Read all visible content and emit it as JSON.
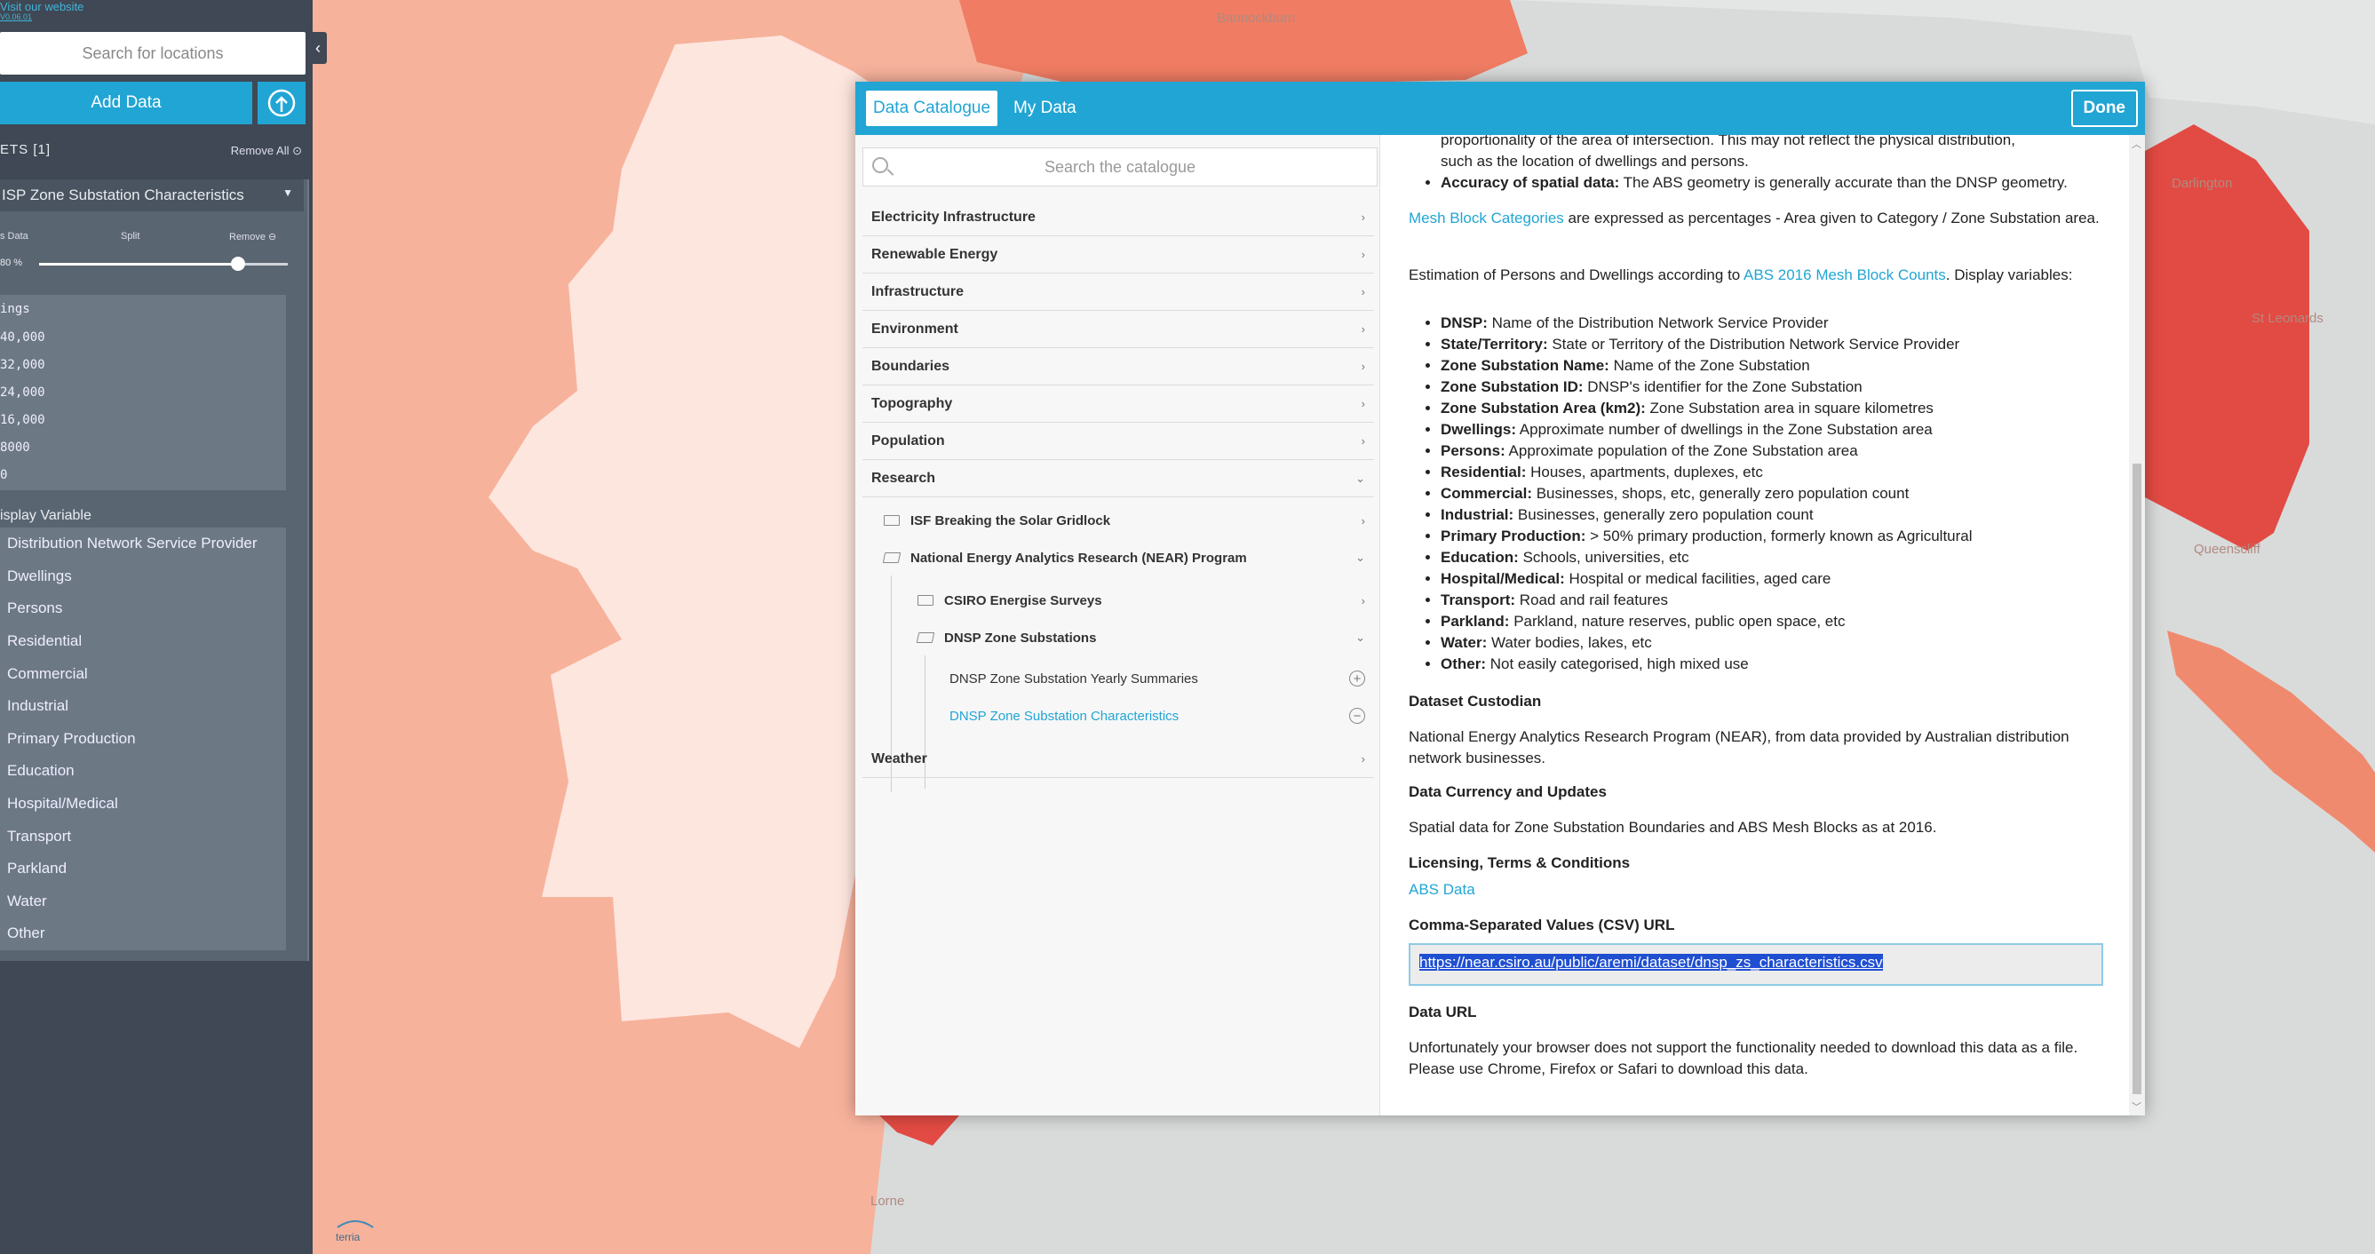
{
  "map": {
    "labels": [
      "Bannockburn",
      "Darlington",
      "St Leonards",
      "Queenscliff",
      "Lorne"
    ],
    "colors": {
      "base": "#d9dbdb",
      "light": "#f9d2c4",
      "lighter": "#fde6de",
      "mid": "#f7b29c",
      "strong": "#ef7c63",
      "dark": "#e24b43"
    }
  },
  "sidebar": {
    "brand": "Visit our website",
    "brand_sub": "V0.06.01",
    "search_placeholder": "Search for locations",
    "add_data": "Add Data",
    "datasets_label": "ETS [1]",
    "remove_all": "Remove All",
    "layer": {
      "title": "ISP Zone Substation Characteristics",
      "controls": {
        "data": "s Data",
        "split": "Split",
        "remove": "Remove"
      },
      "opacity_label": "80 %",
      "opacity": 0.8,
      "legend_title": "ings",
      "legend_values": [
        "40,000",
        "32,000",
        "24,000",
        "16,000",
        "8000",
        "0"
      ],
      "display_variable_label": "isplay Variable",
      "variables": [
        "Distribution Network Service Provider",
        "Dwellings",
        "Persons",
        "Residential",
        "Commercial",
        "Industrial",
        "Primary Production",
        "Education",
        "Hospital/Medical",
        "Transport",
        "Parkland",
        "Water",
        "Other"
      ]
    },
    "logo": "terria"
  },
  "modal": {
    "tabs": [
      "Data Catalogue",
      "My Data"
    ],
    "done": "Done",
    "catalogue": {
      "search_placeholder": "Search the catalogue",
      "groups": [
        "Electricity Infrastructure",
        "Renewable Energy",
        "Infrastructure",
        "Environment",
        "Boundaries",
        "Topography",
        "Population",
        "Research"
      ],
      "research": {
        "isf": "ISF Breaking the Solar Gridlock",
        "near": "National Energy Analytics Research (NEAR) Program",
        "csiro": "CSIRO Energise Surveys",
        "dnsp": "DNSP Zone Substations",
        "yearly": "DNSP Zone Substation Yearly Summaries",
        "characteristics": "DNSP Zone Substation Characteristics"
      },
      "weather": "Weather"
    },
    "details": {
      "prop_line1": "proportionality of the area of intersection. This may not reflect the physical distribution,",
      "prop_line2": "such as the location of dwellings and persons.",
      "accuracy_b": "Accuracy of spatial data:",
      "accuracy": " The ABS geometry is generally accurate than the DNSP geometry.",
      "mesh_link": "Mesh Block Categories",
      "mesh_text": " are expressed as percentages - Area given to Category / Zone Substation area.",
      "est_text": "Estimation of Persons and Dwellings according to ",
      "abs_link": "ABS 2016 Mesh Block Counts",
      "est_tail": ". Display variables:",
      "vars": [
        {
          "b": "DNSP:",
          "t": " Name of the Distribution Network Service Provider"
        },
        {
          "b": "State/Territory:",
          "t": " State or Territory of the Distribution Network Service Provider"
        },
        {
          "b": "Zone Substation Name:",
          "t": " Name of the Zone Substation"
        },
        {
          "b": "Zone Substation ID:",
          "t": " DNSP's identifier for the Zone Substation"
        },
        {
          "b": "Zone Substation Area (km2):",
          "t": " Zone Substation area in square kilometres"
        },
        {
          "b": "Dwellings:",
          "t": " Approximate number of dwellings in the Zone Substation area"
        },
        {
          "b": "Persons:",
          "t": " Approximate population of the Zone Substation area"
        },
        {
          "b": "Residential:",
          "t": " Houses, apartments, duplexes, etc"
        },
        {
          "b": "Commercial:",
          "t": " Businesses, shops, etc, generally zero population count"
        },
        {
          "b": "Industrial:",
          "t": " Businesses, generally zero population count"
        },
        {
          "b": "Primary Production:",
          "t": " > 50% primary production, formerly known as Agricultural"
        },
        {
          "b": "Education:",
          "t": " Schools, universities, etc"
        },
        {
          "b": "Hospital/Medical:",
          "t": " Hospital or medical facilities, aged care"
        },
        {
          "b": "Transport:",
          "t": " Road and rail features"
        },
        {
          "b": "Parkland:",
          "t": " Parkland, nature reserves, public open space, etc"
        },
        {
          "b": "Water:",
          "t": " Water bodies, lakes, etc"
        },
        {
          "b": "Other:",
          "t": " Not easily categorised, high mixed use"
        }
      ],
      "custodian_h": "Dataset Custodian",
      "custodian": "National Energy Analytics Research Program (NEAR), from data provided by Australian distribution network businesses.",
      "currency_h": "Data Currency and Updates",
      "currency": "Spatial data for Zone Substation Boundaries and ABS Mesh Blocks as at 2016.",
      "licensing_h": "Licensing, Terms & Conditions",
      "licensing_link": "ABS Data",
      "csv_h": "Comma-Separated Values (CSV) URL",
      "csv_url": "https://near.csiro.au/public/aremi/dataset/dnsp_zs_characteristics.csv",
      "data_url_h": "Data URL",
      "data_url": "Unfortunately your browser does not support the functionality needed to download this data as a file. Please use Chrome, Firefox or Safari to download this data."
    }
  }
}
